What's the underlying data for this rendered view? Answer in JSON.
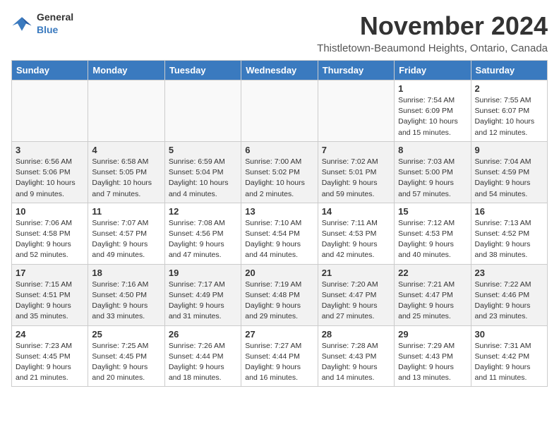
{
  "header": {
    "logo_general": "General",
    "logo_blue": "Blue",
    "month_title": "November 2024",
    "subtitle": "Thistletown-Beaumond Heights, Ontario, Canada"
  },
  "weekdays": [
    "Sunday",
    "Monday",
    "Tuesday",
    "Wednesday",
    "Thursday",
    "Friday",
    "Saturday"
  ],
  "weeks": [
    [
      {
        "day": "",
        "info": ""
      },
      {
        "day": "",
        "info": ""
      },
      {
        "day": "",
        "info": ""
      },
      {
        "day": "",
        "info": ""
      },
      {
        "day": "",
        "info": ""
      },
      {
        "day": "1",
        "info": "Sunrise: 7:54 AM\nSunset: 6:09 PM\nDaylight: 10 hours and 15 minutes."
      },
      {
        "day": "2",
        "info": "Sunrise: 7:55 AM\nSunset: 6:07 PM\nDaylight: 10 hours and 12 minutes."
      }
    ],
    [
      {
        "day": "3",
        "info": "Sunrise: 6:56 AM\nSunset: 5:06 PM\nDaylight: 10 hours and 9 minutes."
      },
      {
        "day": "4",
        "info": "Sunrise: 6:58 AM\nSunset: 5:05 PM\nDaylight: 10 hours and 7 minutes."
      },
      {
        "day": "5",
        "info": "Sunrise: 6:59 AM\nSunset: 5:04 PM\nDaylight: 10 hours and 4 minutes."
      },
      {
        "day": "6",
        "info": "Sunrise: 7:00 AM\nSunset: 5:02 PM\nDaylight: 10 hours and 2 minutes."
      },
      {
        "day": "7",
        "info": "Sunrise: 7:02 AM\nSunset: 5:01 PM\nDaylight: 9 hours and 59 minutes."
      },
      {
        "day": "8",
        "info": "Sunrise: 7:03 AM\nSunset: 5:00 PM\nDaylight: 9 hours and 57 minutes."
      },
      {
        "day": "9",
        "info": "Sunrise: 7:04 AM\nSunset: 4:59 PM\nDaylight: 9 hours and 54 minutes."
      }
    ],
    [
      {
        "day": "10",
        "info": "Sunrise: 7:06 AM\nSunset: 4:58 PM\nDaylight: 9 hours and 52 minutes."
      },
      {
        "day": "11",
        "info": "Sunrise: 7:07 AM\nSunset: 4:57 PM\nDaylight: 9 hours and 49 minutes."
      },
      {
        "day": "12",
        "info": "Sunrise: 7:08 AM\nSunset: 4:56 PM\nDaylight: 9 hours and 47 minutes."
      },
      {
        "day": "13",
        "info": "Sunrise: 7:10 AM\nSunset: 4:54 PM\nDaylight: 9 hours and 44 minutes."
      },
      {
        "day": "14",
        "info": "Sunrise: 7:11 AM\nSunset: 4:53 PM\nDaylight: 9 hours and 42 minutes."
      },
      {
        "day": "15",
        "info": "Sunrise: 7:12 AM\nSunset: 4:53 PM\nDaylight: 9 hours and 40 minutes."
      },
      {
        "day": "16",
        "info": "Sunrise: 7:13 AM\nSunset: 4:52 PM\nDaylight: 9 hours and 38 minutes."
      }
    ],
    [
      {
        "day": "17",
        "info": "Sunrise: 7:15 AM\nSunset: 4:51 PM\nDaylight: 9 hours and 35 minutes."
      },
      {
        "day": "18",
        "info": "Sunrise: 7:16 AM\nSunset: 4:50 PM\nDaylight: 9 hours and 33 minutes."
      },
      {
        "day": "19",
        "info": "Sunrise: 7:17 AM\nSunset: 4:49 PM\nDaylight: 9 hours and 31 minutes."
      },
      {
        "day": "20",
        "info": "Sunrise: 7:19 AM\nSunset: 4:48 PM\nDaylight: 9 hours and 29 minutes."
      },
      {
        "day": "21",
        "info": "Sunrise: 7:20 AM\nSunset: 4:47 PM\nDaylight: 9 hours and 27 minutes."
      },
      {
        "day": "22",
        "info": "Sunrise: 7:21 AM\nSunset: 4:47 PM\nDaylight: 9 hours and 25 minutes."
      },
      {
        "day": "23",
        "info": "Sunrise: 7:22 AM\nSunset: 4:46 PM\nDaylight: 9 hours and 23 minutes."
      }
    ],
    [
      {
        "day": "24",
        "info": "Sunrise: 7:23 AM\nSunset: 4:45 PM\nDaylight: 9 hours and 21 minutes."
      },
      {
        "day": "25",
        "info": "Sunrise: 7:25 AM\nSunset: 4:45 PM\nDaylight: 9 hours and 20 minutes."
      },
      {
        "day": "26",
        "info": "Sunrise: 7:26 AM\nSunset: 4:44 PM\nDaylight: 9 hours and 18 minutes."
      },
      {
        "day": "27",
        "info": "Sunrise: 7:27 AM\nSunset: 4:44 PM\nDaylight: 9 hours and 16 minutes."
      },
      {
        "day": "28",
        "info": "Sunrise: 7:28 AM\nSunset: 4:43 PM\nDaylight: 9 hours and 14 minutes."
      },
      {
        "day": "29",
        "info": "Sunrise: 7:29 AM\nSunset: 4:43 PM\nDaylight: 9 hours and 13 minutes."
      },
      {
        "day": "30",
        "info": "Sunrise: 7:31 AM\nSunset: 4:42 PM\nDaylight: 9 hours and 11 minutes."
      }
    ]
  ]
}
